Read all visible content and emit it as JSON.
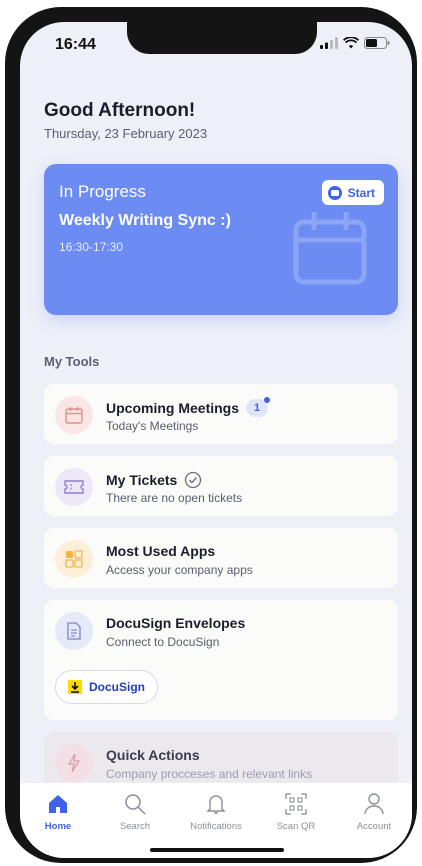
{
  "status_bar": {
    "time": "16:44"
  },
  "header": {
    "greeting": "Good Afternoon!",
    "date": "Thursday, 23 February 2023"
  },
  "in_progress": {
    "status": "In Progress",
    "meeting_title": "Weekly Writing Sync :)",
    "time_range": "16:30-17:30",
    "start_label": "Start",
    "color": "#6c8cf3"
  },
  "tools": {
    "section_title": "My Tools",
    "items": [
      {
        "title": "Upcoming Meetings",
        "subtitle": "Today's Meetings",
        "badge": "1",
        "icon": "calendar-icon",
        "icon_bg": "#fbe6e6"
      },
      {
        "title": "My Tickets",
        "subtitle": "There are no open tickets",
        "icon": "ticket-icon",
        "icon_bg": "#ece8f8"
      },
      {
        "title": "Most Used Apps",
        "subtitle": "Access your company apps",
        "icon": "apps-grid-icon",
        "icon_bg": "#fcefd8"
      },
      {
        "title": "DocuSign Envelopes",
        "subtitle": "Connect to DocuSign",
        "icon": "document-icon",
        "icon_bg": "#e6e9f8",
        "action_label": "DocuSign"
      },
      {
        "title": "Quick Actions",
        "subtitle": "Company procceses and relevant links",
        "icon": "lightning-icon",
        "icon_bg": "#f3dfe4"
      }
    ]
  },
  "bottom_nav": {
    "items": [
      {
        "label": "Home",
        "icon": "home-icon",
        "active": true
      },
      {
        "label": "Search",
        "icon": "search-icon",
        "active": false
      },
      {
        "label": "Notifications",
        "icon": "bell-icon",
        "active": false
      },
      {
        "label": "Scan QR",
        "icon": "qr-scan-icon",
        "active": false
      },
      {
        "label": "Account",
        "icon": "user-icon",
        "active": false
      }
    ]
  },
  "colors": {
    "accent": "#3e63e8",
    "background": "#eef0f8"
  }
}
